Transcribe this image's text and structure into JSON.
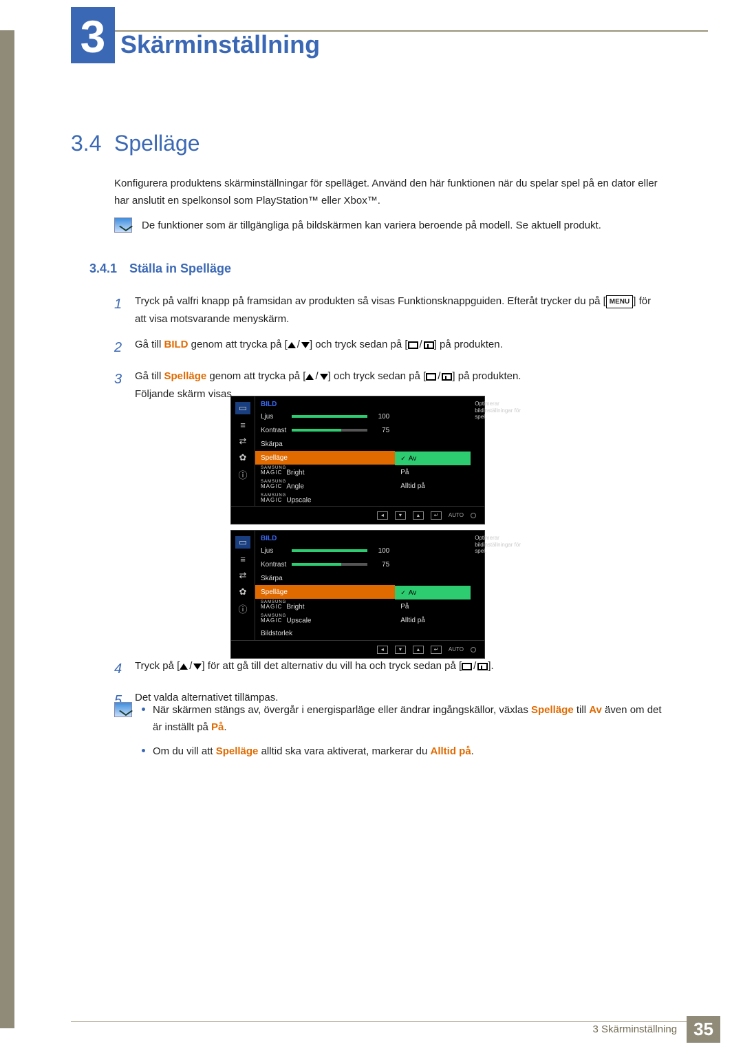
{
  "chapter": {
    "number": "3",
    "title": "Skärminställning"
  },
  "section": {
    "number": "3.4",
    "title": "Spelläge"
  },
  "intro": "Konfigurera produktens skärminställningar för spelläget. Använd den här funktionen när du spelar spel på en dator eller har anslutit en spelkonsol som PlayStation™ eller Xbox™.",
  "note_top": "De funktioner som är tillgängliga på bildskärmen kan variera beroende på modell. Se aktuell produkt.",
  "subsection": {
    "number": "3.4.1",
    "title": "Ställa in Spelläge"
  },
  "steps": {
    "s1_a": "Tryck på valfri knapp på framsidan av produkten så visas Funktionsknappguiden. Efteråt trycker du på [",
    "s1_menu": "MENU",
    "s1_b": "] för att visa motsvarande menyskärm.",
    "s2_a": "Gå till ",
    "s2_bold": "BILD",
    "s2_b": " genom att trycka på [",
    "s2_c": "] och tryck sedan på [",
    "s2_d": "] på produkten.",
    "s3_a": "Gå till ",
    "s3_bold": "Spelläge",
    "s3_b": " genom att trycka på [",
    "s3_c": "] och tryck sedan på [",
    "s3_d": "] på produkten.",
    "s3_e": "Följande skärm visas.",
    "s4_a": "Tryck på [",
    "s4_b": "] för att gå till det alternativ du vill ha och tryck sedan på [",
    "s4_c": "].",
    "s5": "Det valda alternativet tillämpas."
  },
  "notes_bottom": {
    "b1_a": "När skärmen stängs av, övergår i energisparläge eller ändrar ingångskällor, växlas ",
    "b1_bold1": "Spelläge",
    "b1_b": " till ",
    "b1_bold2": "Av",
    "b1_c": " även om det är inställt på ",
    "b1_bold3": "På",
    "b1_d": ".",
    "b2_a": "Om du vill att ",
    "b2_bold1": "Spelläge",
    "b2_b": " alltid ska vara aktiverat, markerar du ",
    "b2_bold2": "Alltid på",
    "b2_c": "."
  },
  "osd": {
    "heading": "BILD",
    "hint": "Optimerar bildinställningar för spel.",
    "rows": {
      "ljus": {
        "label": "Ljus",
        "value": 100,
        "pct": 100
      },
      "kontrast": {
        "label": "Kontrast",
        "value": 75,
        "pct": 65
      },
      "skarpa": {
        "label": "Skärpa"
      },
      "spellage": {
        "label": "Spelläge"
      },
      "magic_bright": "Bright",
      "magic_angle": "Angle",
      "magic_upscale": "Upscale",
      "bildstorlek": "Bildstorlek"
    },
    "options": {
      "av": "Av",
      "pa": "På",
      "alltid": "Alltid på"
    },
    "nav": {
      "auto": "AUTO"
    }
  },
  "footer": {
    "chapter_label": "3 Skärminställning",
    "page": "35"
  }
}
